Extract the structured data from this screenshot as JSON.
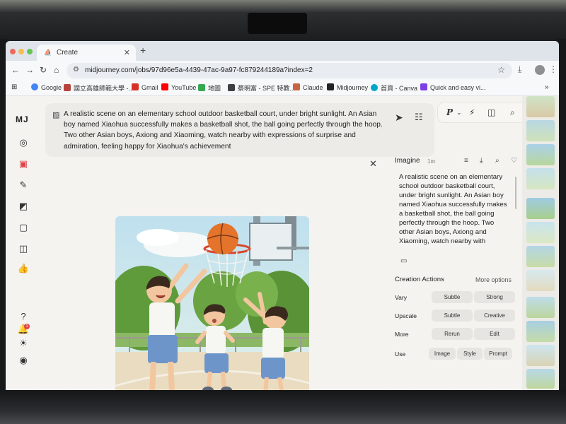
{
  "browser": {
    "tab_title": "Create",
    "url": "midjourney.com/jobs/97d96e5a-4439-47ac-9a97-fc879244189a?index=2",
    "bookmarks": [
      {
        "label": "Google",
        "color": "#4285f4"
      },
      {
        "label": "國立高雄師範大學 -...",
        "color": "#b8433d"
      },
      {
        "label": "Gmail",
        "color": "#d93025"
      },
      {
        "label": "YouTube",
        "color": "#ff0000"
      },
      {
        "label": "地圖",
        "color": "#34a853"
      },
      {
        "label": "蔡明富 - SPE 特教...",
        "color": "#3c4043"
      },
      {
        "label": "Claude",
        "color": "#c96442"
      },
      {
        "label": "Midjourney",
        "color": "#222222"
      },
      {
        "label": "首頁 - Canva",
        "color": "#00a6c8"
      },
      {
        "label": "Quick and easy vi...",
        "color": "#7b3fe4"
      }
    ]
  },
  "app": {
    "logo": "MJ",
    "prompt_text": "A realistic scene on an elementary school outdoor basketball court, under bright sunlight. An Asian boy named Xiaohua successfully makes a basketball shot, the ball going perfectly through the hoop. Two other Asian boys, Axiong and Xiaoming, watch nearby with expressions of surprise and admiration, feeling happy for Xiaohua's achievement",
    "toolbar_p": "P",
    "notification_count": "1"
  },
  "panel": {
    "title": "Imagine",
    "time": "1m",
    "prompt_excerpt": "A realistic scene on an elementary school outdoor basketball court, under bright sunlight. An Asian boy named Xiaohua successfully makes a basketball shot, the ball going perfectly through the hoop. Two other Asian boys, Axiong and Xiaoming, watch nearby with",
    "creation_actions_title": "Creation Actions",
    "more_options": "More options",
    "rows": [
      {
        "label": "Vary",
        "buttons": [
          "Subtle",
          "Strong"
        ]
      },
      {
        "label": "Upscale",
        "buttons": [
          "Subtle",
          "Creative"
        ]
      },
      {
        "label": "More",
        "buttons": [
          "Rerun",
          "Edit"
        ]
      },
      {
        "label": "Use",
        "buttons": [
          "Image",
          "Style",
          "Prompt"
        ]
      }
    ]
  },
  "colors": {
    "accent_red": "#e0424a",
    "panel_bg": "#f4f3f0",
    "pill_bg": "#e6e5e1"
  }
}
